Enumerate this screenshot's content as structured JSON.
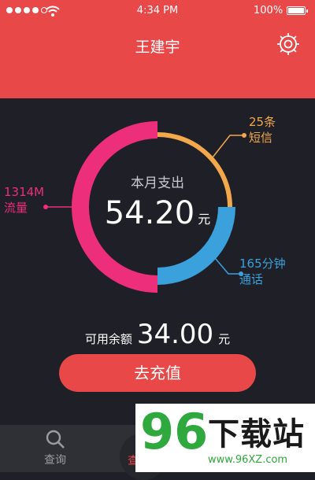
{
  "status_bar": {
    "time": "4:34 PM",
    "battery": "100%"
  },
  "header": {
    "title": "王建宇"
  },
  "summary": {
    "label": "本月支出",
    "amount": "54.20",
    "unit": "元"
  },
  "usage": {
    "sms": {
      "amount": "25条",
      "label": "短信",
      "color": "#f3a94b"
    },
    "calls": {
      "amount": "165分钟",
      "label": "通话",
      "color": "#3aa1dd"
    },
    "data": {
      "amount": "1314M",
      "label": "流量",
      "color": "#ec2e7b"
    }
  },
  "balance": {
    "label": "可用余额",
    "amount": "34.00",
    "unit": "元"
  },
  "recharge_button": "去充值",
  "tabbar": {
    "query_label": "查询",
    "center_label": "查"
  },
  "watermark": {
    "logo": "96",
    "name": "下载站",
    "url": "www.96XZ.com"
  },
  "colors": {
    "accent": "#e84848",
    "background": "#1f1f27",
    "tabbar": "#2f2f36"
  }
}
